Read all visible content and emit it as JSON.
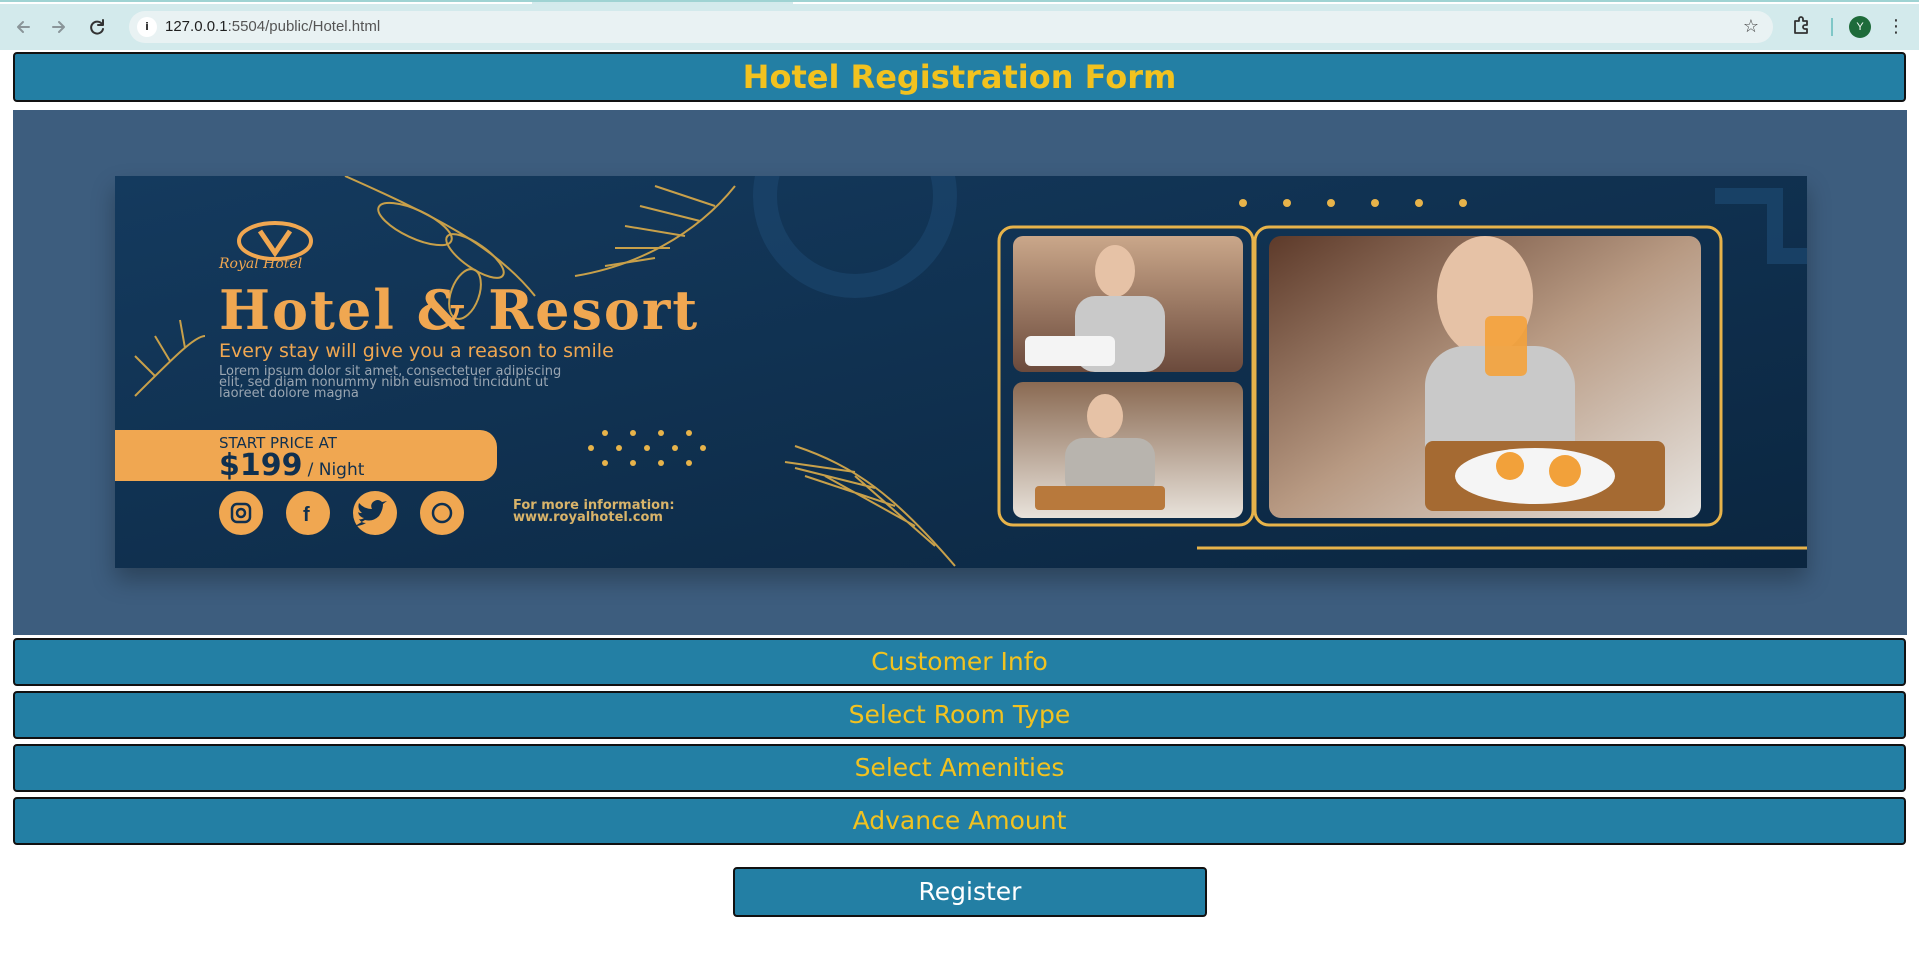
{
  "browser": {
    "url_host": "127.0.0.1",
    "url_port_path": ":5504/public/Hotel.html",
    "avatar_letter": "Y",
    "icons": [
      "back-arrow-icon",
      "forward-arrow-icon",
      "reload-icon",
      "site-info-icon",
      "bookmark-star-icon",
      "extensions-icon",
      "profile-avatar",
      "kebab-menu-icon"
    ]
  },
  "page": {
    "title": "Hotel Registration Form",
    "sections": [
      {
        "label": "Customer Info"
      },
      {
        "label": "Select Room Type"
      },
      {
        "label": "Select Amenities"
      },
      {
        "label": "Advance Amount"
      }
    ],
    "register_label": "Register",
    "colors": {
      "bar_bg": "#237fa4",
      "bar_text": "#f2c21f",
      "banner_frame": "#3d5d7e",
      "banner_bg": "#10304f",
      "gold": "#f0a751"
    }
  },
  "banner": {
    "logo_text": "Royal Hotel",
    "headline": "Hotel & Resort",
    "tagline": "Every stay will give you a reason to smile",
    "body_lines": [
      "Lorem ipsum dolor sit amet, consectetuer adipiscing",
      "elit, sed diam nonummy nibh euismod tincidunt ut",
      "laoreet dolore magna"
    ],
    "price_prefix": "START PRICE AT",
    "price": "$199",
    "price_unit": "/ Night",
    "info_label": "For more information:",
    "info_url": "www.royalhotel.com",
    "social_icons": [
      "instagram-icon",
      "facebook-icon",
      "twitter-icon",
      "whatsapp-icon"
    ]
  }
}
